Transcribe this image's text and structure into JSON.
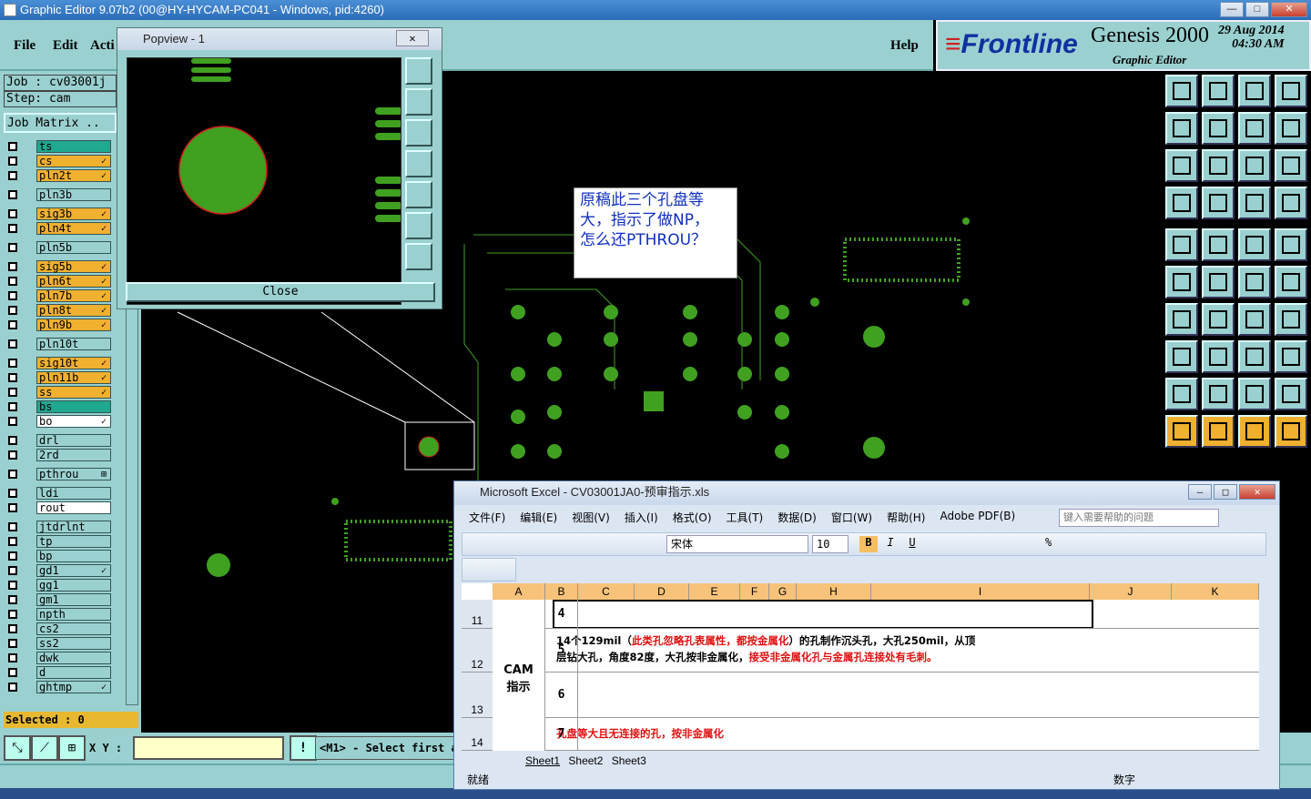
{
  "window": {
    "title": "Graphic Editor 9.07b2 (00@HY-HYCAM-PC041 - Windows, pid:4260)"
  },
  "menu": {
    "file": "File",
    "edit": "Edit",
    "action": "Acti",
    "help": "Help"
  },
  "logo": {
    "brand": "Frontline",
    "product": "Genesis 2000",
    "subtitle": "Graphic Editor",
    "date": "29 Aug 2014",
    "time": "04:30 AM"
  },
  "job": {
    "job_label": "Job : cv03001j",
    "step_label": "Step: cam",
    "matrix_label": "Job Matrix .."
  },
  "layers": [
    {
      "name": "ts",
      "color": "#20a890",
      "flag": ""
    },
    {
      "name": "cs",
      "color": "#f0b030",
      "flag": "✓"
    },
    {
      "name": "pln2t",
      "color": "#f0b030",
      "flag": "✓"
    },
    {
      "name": "pln3b",
      "color": "#9ad0d0",
      "flag": ""
    },
    {
      "name": "sig3b",
      "color": "#f0b030",
      "flag": "✓"
    },
    {
      "name": "pln4t",
      "color": "#f0b030",
      "flag": "✓"
    },
    {
      "name": "pln5b",
      "color": "#9ad0d0",
      "flag": ""
    },
    {
      "name": "sig5b",
      "color": "#f0b030",
      "flag": "✓"
    },
    {
      "name": "pln6t",
      "color": "#f0b030",
      "flag": "✓"
    },
    {
      "name": "pln7b",
      "color": "#f0b030",
      "flag": "✓"
    },
    {
      "name": "pln8t",
      "color": "#f0b030",
      "flag": "✓"
    },
    {
      "name": "pln9b",
      "color": "#f0b030",
      "flag": "✓"
    },
    {
      "name": "pln10t",
      "color": "#9ad0d0",
      "flag": ""
    },
    {
      "name": "sig10t",
      "color": "#f0b030",
      "flag": "✓"
    },
    {
      "name": "pln11b",
      "color": "#f0b030",
      "flag": "✓"
    },
    {
      "name": "ss",
      "color": "#f0b030",
      "flag": "✓"
    },
    {
      "name": "bs",
      "color": "#20a890",
      "flag": ""
    },
    {
      "name": "bo",
      "color": "#ffffff",
      "flag": "✓"
    },
    {
      "name": "drl",
      "color": "#9ad0d0",
      "flag": ""
    },
    {
      "name": "2rd",
      "color": "#9ad0d0",
      "flag": ""
    },
    {
      "name": "pthrou",
      "color": "#9ad0d0",
      "flag": "⊞"
    },
    {
      "name": "ldi",
      "color": "#9ad0d0",
      "flag": ""
    },
    {
      "name": "rout",
      "color": "#ffffff",
      "flag": ""
    },
    {
      "name": "jtdrlnt",
      "color": "#9ad0d0",
      "flag": ""
    },
    {
      "name": "tp",
      "color": "#9ad0d0",
      "flag": ""
    },
    {
      "name": "bp",
      "color": "#9ad0d0",
      "flag": ""
    },
    {
      "name": "gd1",
      "color": "#9ad0d0",
      "flag": "✓"
    },
    {
      "name": "gg1",
      "color": "#9ad0d0",
      "flag": ""
    },
    {
      "name": "gm1",
      "color": "#9ad0d0",
      "flag": ""
    },
    {
      "name": "npth",
      "color": "#9ad0d0",
      "flag": ""
    },
    {
      "name": "cs2",
      "color": "#9ad0d0",
      "flag": ""
    },
    {
      "name": "ss2",
      "color": "#9ad0d0",
      "flag": ""
    },
    {
      "name": "dwk",
      "color": "#9ad0d0",
      "flag": ""
    },
    {
      "name": "d",
      "color": "#9ad0d0",
      "flag": ""
    },
    {
      "name": "ghtmp",
      "color": "#9ad0d0",
      "flag": "✓"
    }
  ],
  "selected": "Selected : 0",
  "bottom": {
    "xy_label": "X Y :",
    "xy_value": "",
    "prompt": "<M1> - Select first a"
  },
  "popview": {
    "title": "Popview - 1",
    "close": "Close"
  },
  "note": {
    "text": "原稿此三个孔盘等\n大，指示了做NP，\n怎么还PTHROU？"
  },
  "excel": {
    "title": "Microsoft Excel - CV03001JA0-预审指示.xls",
    "menu": [
      "文件(F)",
      "编辑(E)",
      "视图(V)",
      "插入(I)",
      "格式(O)",
      "工具(T)",
      "数据(D)",
      "窗口(W)",
      "帮助(H)",
      "Adobe PDF(B)"
    ],
    "help_placeholder": "键入需要帮助的问题",
    "font": "宋体",
    "size": "10",
    "columns": [
      "A",
      "B",
      "C",
      "D",
      "E",
      "F",
      "G",
      "H",
      "I",
      "J",
      "K"
    ],
    "rows": [
      "11",
      "12",
      "13",
      "14"
    ],
    "cam_label": "CAM\n指示",
    "b_values": [
      "4",
      "5",
      "6",
      "7"
    ],
    "row12_black1": "14个129mil（",
    "row12_red1": "此类孔忽略孔表属性，都按金属化",
    "row12_black2": "）的孔制作沉头孔，大孔250mil，从顶",
    "row12_line2_black": "层钻大孔，角度82度，大孔按非金属化，",
    "row12_line2_red": "接受非金属化孔与金属孔连接处有毛刺。",
    "row14_red": "孔盘等大且无连接的孔，按非金属化",
    "sheets": [
      "Sheet1",
      "Sheet2",
      "Sheet3"
    ],
    "status_left": "就绪",
    "status_right": "数字"
  }
}
